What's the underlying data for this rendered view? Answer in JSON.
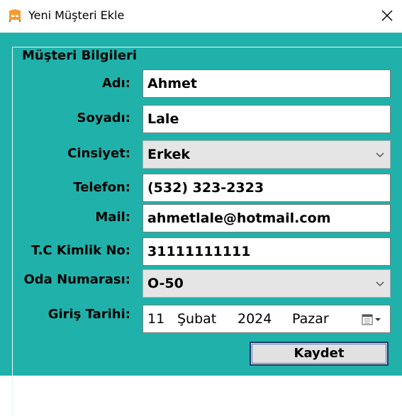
{
  "window": {
    "title": "Yeni Müşteri Ekle",
    "app_icon": "bed-icon",
    "close_icon": "close-icon",
    "background_color": "#20b2aa"
  },
  "group": {
    "legend": "Müşteri Bilgileri"
  },
  "form": {
    "ad": {
      "label": "Adı:",
      "value": "Ahmet"
    },
    "soyad": {
      "label": "Soyadı:",
      "value": "Lale"
    },
    "cinsiyet": {
      "label": "Cinsiyet:",
      "value": "Erkek"
    },
    "telefon": {
      "label": "Telefon:",
      "value": "(532) 323-2323"
    },
    "mail": {
      "label": "Mail:",
      "value": "ahmetlale@hotmail.com"
    },
    "tc": {
      "label": "T.C Kimlik No:",
      "value": "31111111111"
    },
    "oda": {
      "label": "Oda Numarası:",
      "value": "O-50"
    },
    "giris": {
      "label": "Giriş Tarihi:",
      "day": "11",
      "month": "Şubat",
      "year": "2024",
      "weekday": "Pazar",
      "icon": "calendar-icon"
    }
  },
  "actions": {
    "save_label": "Kaydet"
  }
}
